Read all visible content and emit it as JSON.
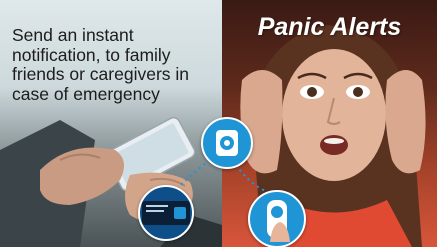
{
  "headline": "Send an instant notification, to family friends or caregivers in case of emergency",
  "title": "Panic Alerts",
  "colors": {
    "accent": "#1f95d6",
    "title_text": "#ffffff",
    "headline_text": "#1c1c1c",
    "right_bg": "#a8442a"
  },
  "icons": [
    "alarm-device-icon",
    "phone-alert-icon",
    "panic-button-icon"
  ]
}
